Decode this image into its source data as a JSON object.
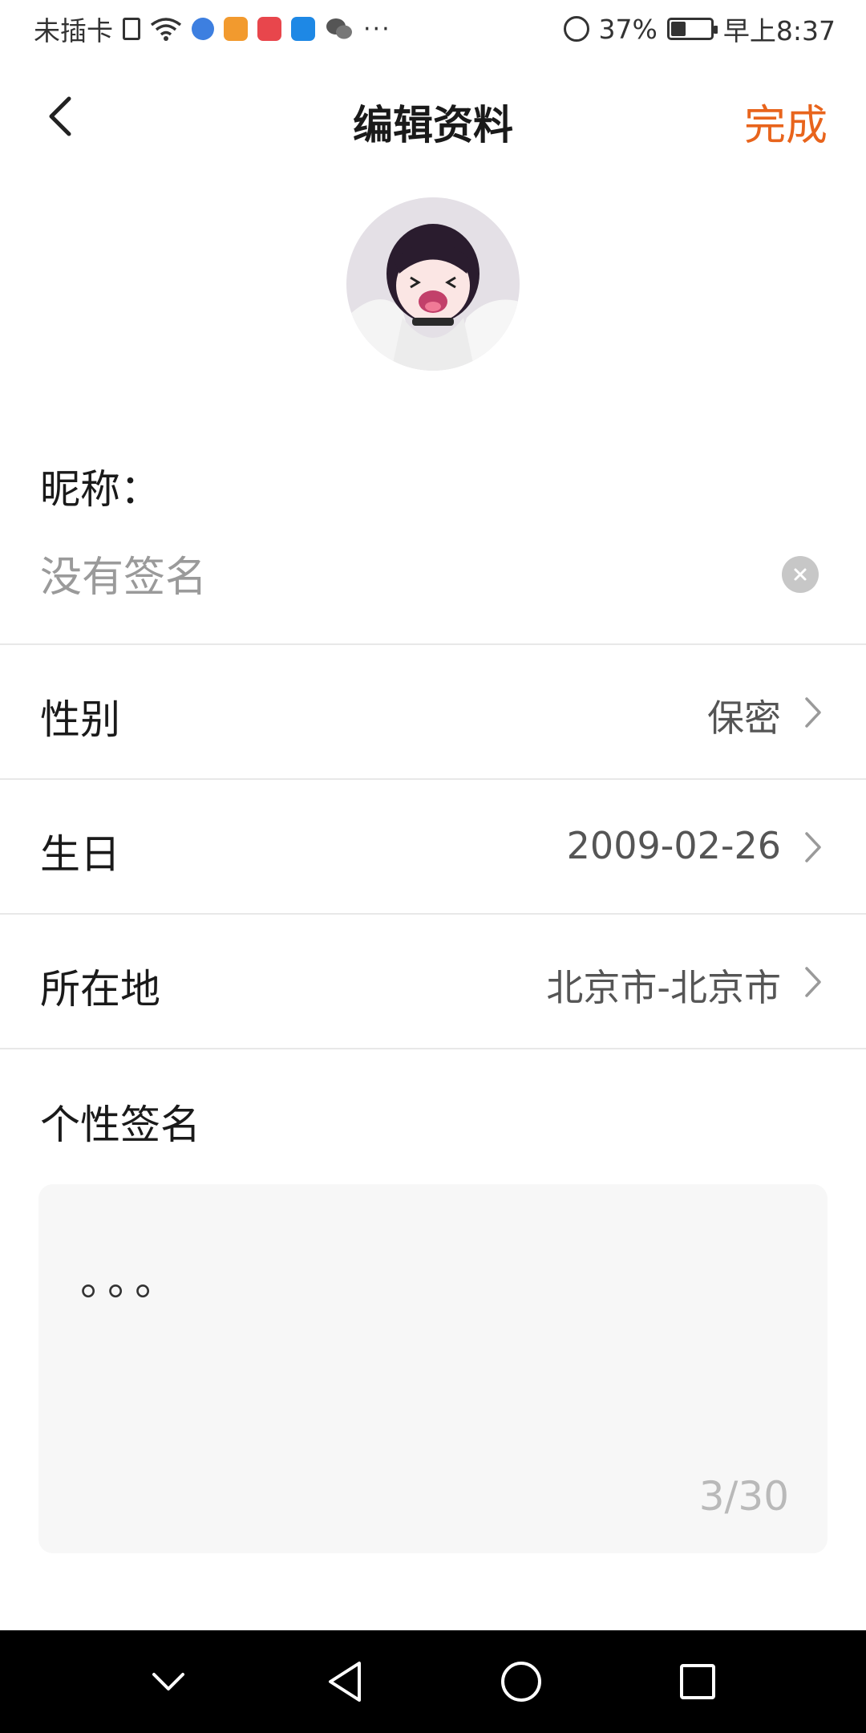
{
  "status_bar": {
    "carrier": "未插卡",
    "battery_percent": "37%",
    "time": "早上8:37",
    "battery_level": 0.37,
    "icons": [
      "sim-icon",
      "wifi-icon",
      "browser-icon",
      "video-app-icon",
      "huawei-app-icon",
      "blue-app-icon",
      "wechat-icon",
      "more-dots-icon",
      "alarm-icon",
      "battery-icon"
    ]
  },
  "header": {
    "title": "编辑资料",
    "done_label": "完成",
    "accent_color": "#e8641c"
  },
  "profile": {
    "nickname_label": "昵称：",
    "nickname_placeholder": "没有签名",
    "rows": [
      {
        "label": "性别",
        "value": "保密"
      },
      {
        "label": "生日",
        "value": "2009-02-26"
      },
      {
        "label": "所在地",
        "value": "北京市-北京市"
      }
    ],
    "signature_label": "个性签名",
    "signature_text": "。。。",
    "signature_count": "3/30"
  }
}
